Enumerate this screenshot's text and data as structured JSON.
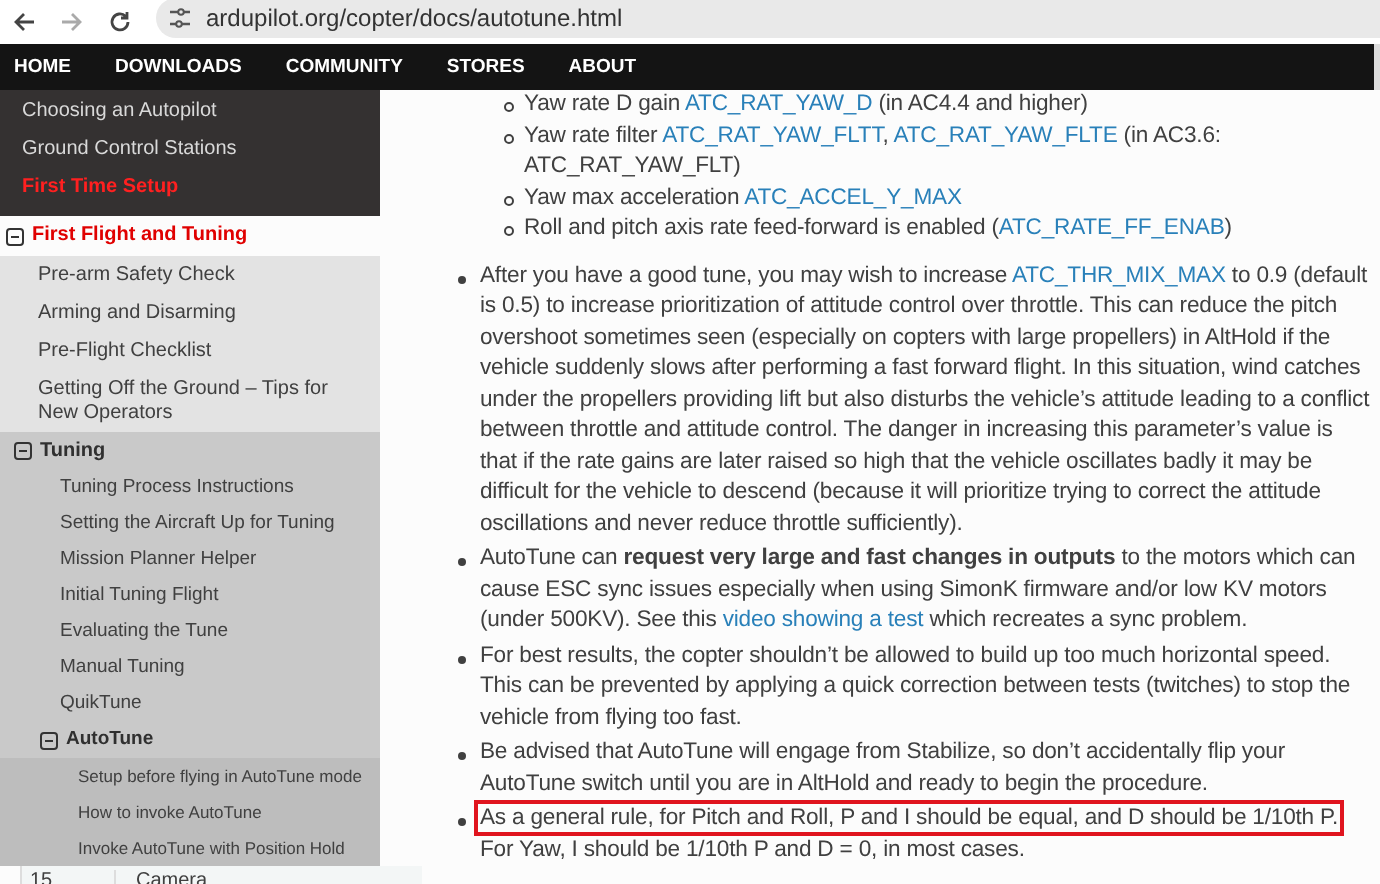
{
  "browser": {
    "url": "ardupilot.org/copter/docs/autotune.html"
  },
  "nav": [
    {
      "label": "HOME"
    },
    {
      "label": "DOWNLOADS"
    },
    {
      "label": "COMMUNITY"
    },
    {
      "label": "STORES"
    },
    {
      "label": "ABOUT"
    }
  ],
  "sidebar": {
    "top_items": [
      {
        "label": "Choosing an Autopilot",
        "current": false
      },
      {
        "label": "Ground Control Stations",
        "current": false
      },
      {
        "label": "First Time Setup",
        "current": true
      }
    ],
    "tree": [
      {
        "label": "First Flight and Tuning",
        "current": true,
        "expanded": true,
        "children": [
          {
            "label": "Pre-arm Safety Check"
          },
          {
            "label": "Arming and Disarming"
          },
          {
            "label": "Pre-Flight Checklist"
          },
          {
            "label": "Getting Off the Ground – Tips for New Operators"
          },
          {
            "label": "Tuning",
            "expanded": true,
            "children": [
              {
                "label": "Tuning Process Instructions"
              },
              {
                "label": "Setting the Aircraft Up for Tuning"
              },
              {
                "label": "Mission Planner Helper"
              },
              {
                "label": "Initial Tuning Flight"
              },
              {
                "label": "Evaluating the Tune"
              },
              {
                "label": "Manual Tuning"
              },
              {
                "label": "QuikTune"
              },
              {
                "label": "AutoTune",
                "expanded": true,
                "children": [
                  {
                    "label": "Setup before flying in AutoTune mode"
                  },
                  {
                    "label": "How to invoke AutoTune"
                  },
                  {
                    "label": "Invoke AutoTune with Position Hold"
                  }
                ]
              }
            ]
          }
        ]
      }
    ],
    "bottom_row": {
      "column_1": "15",
      "column_2": "Camera"
    }
  },
  "content": {
    "sub_items": [
      {
        "parts": [
          {
            "kind": "text",
            "text": "Yaw rate D gain "
          },
          {
            "kind": "link",
            "text": "ATC_RAT_YAW_D"
          },
          {
            "kind": "text",
            "text": " (in AC4.4 and higher)"
          }
        ]
      },
      {
        "parts": [
          {
            "kind": "text",
            "text": "Yaw rate filter "
          },
          {
            "kind": "link",
            "text": "ATC_RAT_YAW_FLTT"
          },
          {
            "kind": "text",
            "text": ", "
          },
          {
            "kind": "link",
            "text": "ATC_RAT_YAW_FLTE"
          },
          {
            "kind": "text",
            "text": " (in AC3.6: ATC_RAT_YAW_FLT)"
          }
        ]
      },
      {
        "parts": [
          {
            "kind": "text",
            "text": "Yaw max acceleration "
          },
          {
            "kind": "link",
            "text": "ATC_ACCEL_Y_MAX"
          }
        ]
      },
      {
        "parts": [
          {
            "kind": "text",
            "text": "Roll and pitch axis rate feed-forward is enabled ("
          },
          {
            "kind": "link",
            "text": "ATC_RATE_FF_ENAB"
          },
          {
            "kind": "text",
            "text": ")"
          }
        ]
      }
    ],
    "bullets": [
      {
        "parts": [
          {
            "kind": "text",
            "text": "After you have a good tune, you may wish to increase "
          },
          {
            "kind": "link",
            "text": "ATC_THR_MIX_MAX"
          },
          {
            "kind": "text",
            "text": " to 0.9 (default is 0.5) to increase prioritization of attitude control over throttle. This can reduce the pitch overshoot sometimes seen (especially on copters with large propellers) in AltHold if the vehicle suddenly slows after performing a fast forward flight. In this situation, wind catches under the propellers providing lift but also disturbs the vehicle’s attitude leading to a conflict between throttle and attitude control. The danger in increasing this parameter’s value is that if the rate gains are later raised so high that the vehicle oscillates badly it may be difficult for the vehicle to descend (because it will prioritize trying to correct the attitude oscillations and never reduce throttle sufficiently)."
          }
        ]
      },
      {
        "parts": [
          {
            "kind": "text",
            "text": "AutoTune can **request very large and fast changes in outputs** to the motors which can cause ESC sync issues especially when using SimonK firmware and/or low KV motors (under 500KV). See this "
          },
          {
            "kind": "link",
            "text": "video showing a test"
          },
          {
            "kind": "text",
            "text": " which recreates a sync problem."
          }
        ]
      },
      {
        "parts": [
          {
            "kind": "text",
            "text": "For best results, the copter shouldn’t be allowed to build up too much horizontal speed. This can be prevented by applying a quick correction between tests (twitches) to stop the vehicle from flying too fast."
          }
        ]
      },
      {
        "parts": [
          {
            "kind": "text",
            "text": "Be advised that AutoTune will engage from Stabilize, so don’t accidentally flip your AutoTune switch until you are in AltHold and ready to begin the procedure."
          }
        ]
      },
      {
        "parts": [
          {
            "kind": "marked",
            "text": "As a general rule, for Pitch and Roll, P and I should be equal, and D should be 1/10th P."
          },
          {
            "kind": "text",
            "text": " For Yaw, I should be 1/10th P and D = 0, in most cases."
          }
        ]
      }
    ]
  }
}
